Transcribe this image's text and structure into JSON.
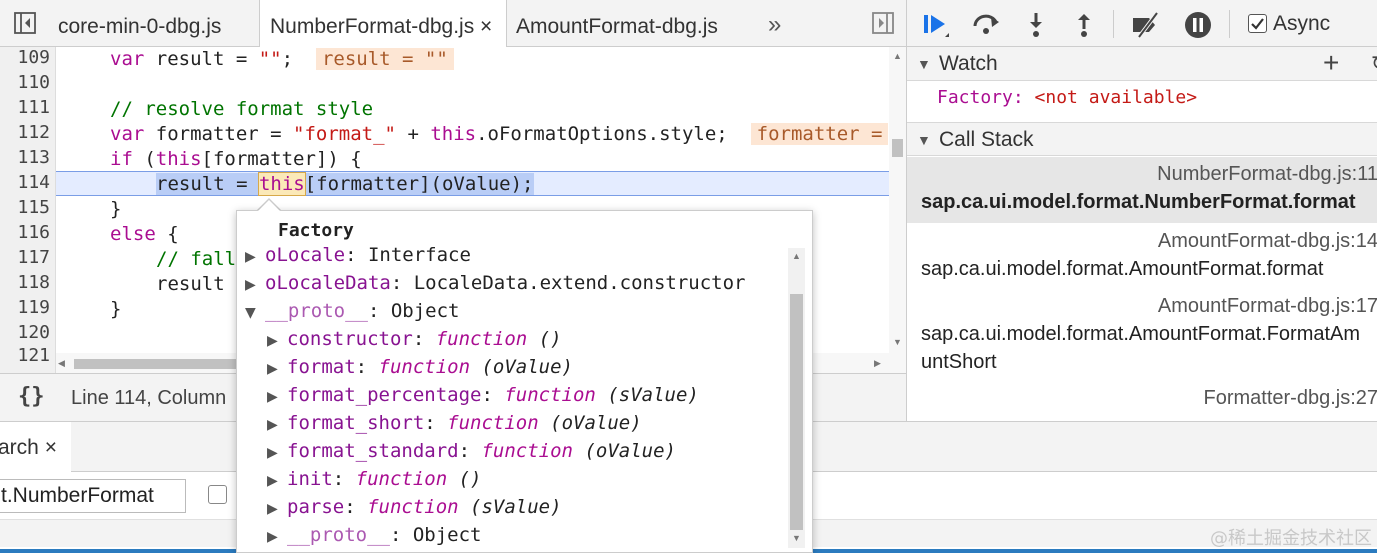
{
  "tabs": [
    {
      "label": "core-min-0-dbg.js",
      "active": false
    },
    {
      "label": "NumberFormat-dbg.js",
      "active": true
    },
    {
      "label": "AmountFormat-dbg.js",
      "active": false
    }
  ],
  "tab_close": "×",
  "more_tabs": "»",
  "editor": {
    "line_numbers": [
      "109",
      "110",
      "111",
      "112",
      "113",
      "114",
      "115",
      "116",
      "117",
      "118",
      "119",
      "120",
      "121"
    ],
    "inline_values": {
      "line109": "result = \"\"",
      "line112": "formatter ="
    },
    "code": {
      "l109_kw": "var",
      "l109_a": " result = ",
      "l109_str": "\"\"",
      "l109_b": ";  ",
      "l111_cmt": "// resolve format style",
      "l112_kw": "var",
      "l112_a": " formatter = ",
      "l112_str": "\"format_\"",
      "l112_b": " + ",
      "l112_this": "this",
      "l112_c": ".oFormatOptions.style;  ",
      "l113_kw": "if",
      "l113_a": " (",
      "l113_this": "this",
      "l113_b": "[formatter]) {",
      "l114_a": "result = ",
      "l114_this": "this",
      "l114_b": "[formatter](oValue);",
      "l115": "}",
      "l116_kw": "else",
      "l116_a": " {",
      "l117_cmt": "// fall",
      "l118": "result",
      "l119": "}"
    }
  },
  "status": {
    "pretty_print": "{}",
    "cursor": "Line 114, Column"
  },
  "popover": {
    "title": "Factory",
    "properties": [
      {
        "key": "oLocale",
        "sep": ": ",
        "value": "Interface",
        "expanded": false,
        "indent": 0,
        "kind": "obj"
      },
      {
        "key": "oLocaleData",
        "sep": ": ",
        "value": "LocaleData.extend.constructor",
        "expanded": false,
        "indent": 0,
        "kind": "obj"
      },
      {
        "key": "__proto__",
        "sep": ": ",
        "value": "Object",
        "expanded": true,
        "indent": 0,
        "kind": "obj"
      },
      {
        "key": "constructor",
        "sep": ": ",
        "value": "function",
        "sig": " ()",
        "expanded": false,
        "indent": 1,
        "kind": "fn"
      },
      {
        "key": "format",
        "sep": ": ",
        "value": "function",
        "sig": " (oValue)",
        "expanded": false,
        "indent": 1,
        "kind": "fn"
      },
      {
        "key": "format_percentage",
        "sep": ": ",
        "value": "function",
        "sig": " (sValue)",
        "expanded": false,
        "indent": 1,
        "kind": "fn"
      },
      {
        "key": "format_short",
        "sep": ": ",
        "value": "function",
        "sig": " (oValue)",
        "expanded": false,
        "indent": 1,
        "kind": "fn"
      },
      {
        "key": "format_standard",
        "sep": ": ",
        "value": "function",
        "sig": " (oValue)",
        "expanded": false,
        "indent": 1,
        "kind": "fn"
      },
      {
        "key": "init",
        "sep": ": ",
        "value": "function",
        "sig": " ()",
        "expanded": false,
        "indent": 1,
        "kind": "fn"
      },
      {
        "key": "parse",
        "sep": ": ",
        "value": "function",
        "sig": " (sValue)",
        "expanded": false,
        "indent": 1,
        "kind": "fn"
      },
      {
        "key": "__proto__",
        "sep": ": ",
        "value": "Object",
        "expanded": false,
        "indent": 1,
        "kind": "obj"
      }
    ]
  },
  "debugger": {
    "async_label": "Async",
    "async_checked": true,
    "watch": {
      "title": "Watch",
      "add": "+",
      "refresh": "↻",
      "expr_key": "Factory:",
      "expr_value": "<not available>"
    },
    "callstack": {
      "title": "Call Stack",
      "frames": [
        {
          "file": "NumberFormat-dbg.js:11",
          "fn": "sap.ca.ui.model.format.NumberFormat.format"
        },
        {
          "file": "AmountFormat-dbg.js:14",
          "fn": "sap.ca.ui.model.format.AmountFormat.format"
        },
        {
          "file": "AmountFormat-dbg.js:17",
          "fn": "sap.ca.ui.model.format.AmountFormat.FormatAm",
          "fn2": "untShort"
        },
        {
          "file": "Formatter-dbg.js:27",
          "fn": ""
        }
      ]
    }
  },
  "drawer": {
    "search_tab": "arch",
    "search_close": "×",
    "search_value": "t.NumberFormat"
  },
  "watermark": "@稀土掘金技术社区",
  "colors": {
    "keyword": "#aa0d91",
    "string": "#c41a16",
    "comment": "#007400",
    "accent": "#1a73e8",
    "exec_line": "#e4ecff"
  }
}
